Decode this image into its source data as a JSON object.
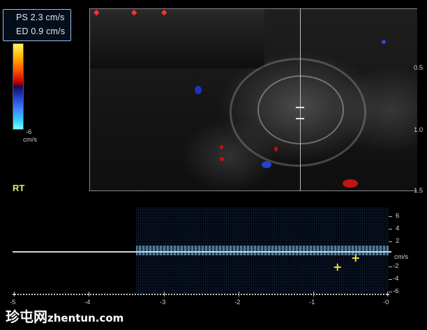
{
  "measurements": {
    "ps": "PS  2.3 cm/s",
    "ed": "ED  0.9 cm/s"
  },
  "color_scale": {
    "bottom_value": "-6",
    "unit": "cm/s"
  },
  "side_label": "RT",
  "depth_scale": [
    "0.5",
    "1.0",
    "1.5"
  ],
  "velocity_scale": {
    "labels": [
      "6",
      "4",
      "2",
      "cm/s",
      "-2",
      "-4",
      "-6"
    ],
    "unit": "cm/s"
  },
  "time_axis": {
    "labels": [
      "-5",
      "-4",
      "-3",
      "-2",
      "-1",
      "-0"
    ]
  },
  "watermark": {
    "cn": "珍屯网",
    "url": "zhentun.com"
  },
  "colors": {
    "accent_yellow": "#e8e86a",
    "caliper": "#f2e34a",
    "doppler_red": "#d01010",
    "doppler_blue": "#1c35b8"
  }
}
